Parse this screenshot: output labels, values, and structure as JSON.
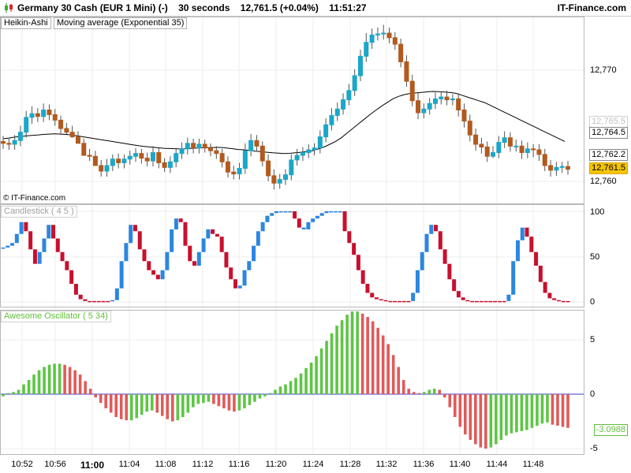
{
  "header": {
    "instrument": "Germany 30 Cash (EUR 1 Mini) (-)",
    "interval": "30 seconds",
    "quote": "12,761.5 (+0.04%)",
    "time": "11:51:27",
    "brand": "IT-Finance.com",
    "logo_icon": "candlestick-icon"
  },
  "price_panel": {
    "legend": [
      "Heikin-Ashi",
      "Moving average (Exponential 35)"
    ],
    "copyright": "© IT-Finance.com",
    "axis_ticks": [
      "12,770",
      "12,760"
    ],
    "labels": {
      "ema": "12,764.5",
      "top": "12,762.2",
      "last": "12,761.5",
      "hidden": "12,765.5"
    }
  },
  "stoch_panel": {
    "legend": "Candlestick ( 4 5 )",
    "axis_ticks": [
      "100",
      "50",
      "0"
    ]
  },
  "ao_panel": {
    "legend": "Awesome Oscillator ( 5 34)",
    "axis_ticks": [
      "5",
      "0",
      "-5"
    ],
    "value_label": "-3.0988"
  },
  "time_axis": [
    "10:52",
    "10:56",
    "11:00",
    "11:04",
    "11:08",
    "11:12",
    "11:16",
    "11:20",
    "11:24",
    "11:28",
    "11:32",
    "11:36",
    "11:40",
    "11:44",
    "11:48"
  ],
  "colors": {
    "bull": "#1aa7c9",
    "bear": "#b25a1e",
    "stoch_up": "#2c86e0",
    "stoch_down": "#c8102e",
    "ao_up": "#5ec545",
    "ao_down": "#e05a5a",
    "ema": "#000000",
    "zero_line": "#3a3acc",
    "last_price_bg": "#f5c400"
  },
  "chart_data": [
    {
      "type": "candlestick",
      "title": "Heikin-Ashi",
      "ylim": [
        12758,
        12778
      ],
      "open": [
        12764.6,
        12764.4,
        12764.3,
        12764.7,
        12765.6,
        12767.2,
        12767.6,
        12767.3,
        12768.0,
        12767.5,
        12766.9,
        12766.0,
        12765.6,
        12765.1,
        12764.4,
        12763.1,
        12763.0,
        12762.0,
        12761.4,
        12762.0,
        12762.7,
        12762.3,
        12762.7,
        12763.0,
        12763.3,
        12762.8,
        12762.5,
        12763.4,
        12762.3,
        12761.8,
        12762.4,
        12763.3,
        12763.8,
        12764.4,
        12763.9,
        12764.3,
        12763.9,
        12763.6,
        12763.3,
        12762.4,
        12761.3,
        12761.1,
        12761.7,
        12763.6,
        12764.7,
        12764.1,
        12762.5,
        12760.9,
        12760.1,
        12760.5,
        12761.0,
        12762.6,
        12763.1,
        12763.4,
        12763.7,
        12763.9,
        12765.1,
        12766.4,
        12767.4,
        12768.1,
        12769.1,
        12770.1,
        12771.7,
        12773.8,
        12775.3,
        12776.1,
        12776.2,
        12776.3,
        12775.8,
        12775.1,
        12773.2,
        12771.1,
        12769.0,
        12767.7,
        12768.1,
        12768.7,
        12769.2,
        12769.4,
        12769.1,
        12769.2,
        12768.0,
        12766.8,
        12765.3,
        12764.3,
        12764.0,
        12763.0,
        12763.4,
        12764.5,
        12765.0,
        12764.1,
        12764.1,
        12763.4,
        12763.8,
        12763.7,
        12763.2,
        12762.0,
        12761.5,
        12761.8,
        12761.9
      ],
      "close": [
        12764.4,
        12764.3,
        12764.7,
        12765.6,
        12767.2,
        12767.6,
        12767.3,
        12768.0,
        12767.5,
        12766.9,
        12766.0,
        12765.6,
        12765.1,
        12764.4,
        12763.1,
        12763.0,
        12762.0,
        12761.4,
        12762.0,
        12762.7,
        12762.3,
        12762.7,
        12763.0,
        12763.3,
        12762.8,
        12762.5,
        12763.4,
        12762.3,
        12761.8,
        12762.4,
        12763.3,
        12763.8,
        12764.4,
        12763.9,
        12764.3,
        12763.9,
        12763.6,
        12763.3,
        12762.4,
        12761.3,
        12761.1,
        12761.7,
        12763.6,
        12764.7,
        12764.1,
        12762.5,
        12760.9,
        12760.1,
        12760.5,
        12761.0,
        12762.6,
        12763.1,
        12763.4,
        12763.7,
        12763.9,
        12765.1,
        12766.4,
        12767.4,
        12768.1,
        12769.1,
        12770.1,
        12771.7,
        12773.8,
        12775.3,
        12776.1,
        12776.2,
        12776.3,
        12775.8,
        12775.1,
        12773.2,
        12771.1,
        12769.0,
        12767.7,
        12768.1,
        12768.7,
        12769.2,
        12769.4,
        12769.1,
        12769.2,
        12768.0,
        12766.8,
        12765.3,
        12764.3,
        12764.0,
        12763.0,
        12763.4,
        12764.5,
        12765.0,
        12764.1,
        12764.1,
        12763.4,
        12763.8,
        12763.7,
        12763.2,
        12762.0,
        12761.5,
        12761.8,
        12761.9,
        12761.6
      ],
      "high": [
        12765.2,
        12765.0,
        12765.3,
        12766.3,
        12767.9,
        12768.4,
        12768.2,
        12768.7,
        12768.6,
        12768.1,
        12767.4,
        12766.6,
        12766.3,
        12765.7,
        12764.9,
        12763.8,
        12763.6,
        12762.6,
        12762.7,
        12763.2,
        12763.3,
        12763.2,
        12763.6,
        12763.9,
        12763.8,
        12763.4,
        12764.1,
        12763.9,
        12762.8,
        12763.0,
        12763.9,
        12764.5,
        12765.0,
        12764.9,
        12764.9,
        12764.8,
        12764.4,
        12764.1,
        12763.8,
        12763.0,
        12762.0,
        12762.3,
        12764.4,
        12765.4,
        12765.3,
        12764.6,
        12763.2,
        12761.6,
        12761.1,
        12761.6,
        12763.2,
        12763.8,
        12764.0,
        12764.3,
        12764.4,
        12765.8,
        12767.1,
        12768.2,
        12768.8,
        12769.8,
        12770.8,
        12772.4,
        12774.5,
        12776.3,
        12776.8,
        12776.9,
        12777.2,
        12776.9,
        12776.4,
        12775.7,
        12773.9,
        12771.8,
        12769.8,
        12768.7,
        12769.3,
        12769.9,
        12770.0,
        12770.1,
        12769.7,
        12769.8,
        12768.7,
        12767.5,
        12766.0,
        12765.0,
        12764.6,
        12764.1,
        12765.2,
        12765.7,
        12765.6,
        12764.8,
        12764.7,
        12764.5,
        12764.3,
        12764.3,
        12763.8,
        12762.6,
        12762.4,
        12762.4,
        12762.5
      ],
      "low": [
        12763.8,
        12763.7,
        12763.7,
        12764.1,
        12765.0,
        12766.5,
        12766.7,
        12766.7,
        12766.9,
        12766.3,
        12765.4,
        12765.4,
        12765.0,
        12764.5,
        12763.4,
        12762.5,
        12762.4,
        12760.8,
        12760.8,
        12761.4,
        12761.7,
        12761.7,
        12762.1,
        12762.4,
        12762.2,
        12761.9,
        12761.9,
        12761.7,
        12761.3,
        12761.2,
        12761.8,
        12762.7,
        12763.2,
        12763.3,
        12763.3,
        12763.4,
        12763.0,
        12762.7,
        12761.8,
        12760.7,
        12760.5,
        12760.5,
        12761.1,
        12763.0,
        12763.5,
        12761.9,
        12760.3,
        12759.4,
        12759.5,
        12759.9,
        12760.4,
        12762.0,
        12762.5,
        12762.8,
        12763.1,
        12763.3,
        12764.5,
        12765.8,
        12766.8,
        12767.5,
        12768.5,
        12769.5,
        12771.1,
        12773.2,
        12774.6,
        12775.5,
        12775.6,
        12775.2,
        12774.5,
        12772.6,
        12770.5,
        12768.4,
        12767.0,
        12767.1,
        12767.5,
        12768.1,
        12768.6,
        12768.5,
        12768.5,
        12767.3,
        12766.1,
        12764.6,
        12763.6,
        12763.3,
        12762.4,
        12762.8,
        12762.8,
        12763.9,
        12763.5,
        12763.5,
        12762.7,
        12762.8,
        12762.9,
        12762.5,
        12761.4,
        12760.8,
        12760.9,
        12761.2,
        12761.0
      ]
    },
    {
      "type": "line",
      "title": "Moving average (Exponential 35)",
      "values": [
        12764.9,
        12764.97,
        12765.07,
        12765.13,
        12765.2,
        12765.26,
        12765.3,
        12765.36,
        12765.4,
        12765.43,
        12765.4,
        12765.36,
        12765.3,
        12765.2,
        12765.1,
        12765.0,
        12764.9,
        12764.8,
        12764.7,
        12764.6,
        12764.5,
        12764.4,
        12764.3,
        12764.2,
        12764.1,
        12764.04,
        12763.98,
        12763.92,
        12763.86,
        12763.84,
        12763.82,
        12763.8,
        12763.82,
        12763.86,
        12763.9,
        12763.92,
        12763.94,
        12763.96,
        12763.96,
        12763.9,
        12763.82,
        12763.74,
        12763.7,
        12763.64,
        12763.56,
        12763.5,
        12763.44,
        12763.38,
        12763.34,
        12763.3,
        12763.32,
        12763.38,
        12763.44,
        12763.5,
        12763.6,
        12763.8,
        12764.0,
        12764.3,
        12764.6,
        12765.0,
        12765.5,
        12766.0,
        12766.5,
        12767.0,
        12767.5,
        12767.96,
        12768.4,
        12768.8,
        12769.2,
        12769.46,
        12769.66,
        12769.78,
        12769.84,
        12769.9,
        12769.96,
        12770.0,
        12769.98,
        12769.94,
        12769.88,
        12769.8,
        12769.6,
        12769.4,
        12769.2,
        12769.0,
        12768.8,
        12768.5,
        12768.2,
        12767.9,
        12767.6,
        12767.3,
        12767.0,
        12766.7,
        12766.4,
        12766.1,
        12765.8,
        12765.5,
        12765.2,
        12764.9,
        12764.6
      ]
    },
    {
      "type": "bar",
      "title": "Candlestick ( 4 5 )",
      "ylim": [
        0,
        100
      ],
      "values": [
        60,
        62,
        65,
        75,
        88,
        78,
        58,
        42,
        55,
        70,
        85,
        70,
        55,
        45,
        35,
        20,
        8,
        3,
        1,
        1,
        1,
        1,
        1,
        1,
        2,
        15,
        45,
        65,
        85,
        78,
        58,
        45,
        35,
        30,
        25,
        35,
        55,
        80,
        92,
        88,
        62,
        45,
        40,
        55,
        70,
        80,
        75,
        72,
        55,
        38,
        25,
        15,
        18,
        35,
        45,
        62,
        78,
        88,
        95,
        98,
        100,
        100,
        100,
        100,
        92,
        82,
        80,
        88,
        92,
        95,
        98,
        100,
        100,
        100,
        100,
        78,
        65,
        52,
        35,
        20,
        10,
        5,
        3,
        2,
        1,
        1,
        1,
        1,
        1,
        1,
        10,
        35,
        55,
        75,
        85,
        78,
        58,
        42,
        25,
        12,
        5,
        2,
        1,
        1,
        1,
        1,
        1,
        1,
        1,
        1,
        1,
        8,
        45,
        68,
        82,
        72,
        55,
        40,
        22,
        10,
        4,
        2,
        1,
        1,
        1
      ],
      "rising": [
        true,
        true,
        true,
        true,
        true,
        false,
        false,
        false,
        true,
        true,
        true,
        false,
        false,
        false,
        false,
        false,
        false,
        false,
        false,
        false,
        false,
        false,
        false,
        false,
        true,
        true,
        true,
        true,
        true,
        false,
        false,
        false,
        false,
        false,
        false,
        true,
        true,
        true,
        true,
        false,
        false,
        false,
        false,
        true,
        true,
        true,
        false,
        false,
        false,
        false,
        false,
        false,
        true,
        true,
        true,
        true,
        true,
        true,
        true,
        true,
        true,
        true,
        true,
        true,
        false,
        false,
        true,
        true,
        true,
        true,
        true,
        true,
        true,
        true,
        true,
        false,
        false,
        false,
        false,
        false,
        false,
        false,
        false,
        false,
        false,
        false,
        false,
        false,
        false,
        false,
        true,
        true,
        true,
        true,
        true,
        false,
        false,
        false,
        false,
        false,
        false,
        false,
        false,
        false,
        false,
        false,
        false,
        false,
        false,
        false,
        false,
        true,
        true,
        true,
        true,
        false,
        false,
        false,
        false,
        false,
        false,
        false,
        false,
        false,
        false
      ]
    },
    {
      "type": "bar",
      "title": "Awesome Oscillator ( 5 34)",
      "ylim": [
        -5,
        7
      ],
      "values": [
        -0.2,
        0.1,
        0.2,
        0.4,
        0.9,
        1.3,
        1.8,
        2.2,
        2.5,
        2.7,
        2.8,
        2.8,
        2.7,
        2.5,
        2.2,
        1.8,
        1.2,
        0.5,
        -0.3,
        -0.8,
        -1.3,
        -1.7,
        -2.1,
        -2.3,
        -2.4,
        -2.4,
        -2.2,
        -1.9,
        -1.6,
        -1.5,
        -1.7,
        -2.0,
        -2.3,
        -2.5,
        -2.4,
        -2.1,
        -1.7,
        -1.2,
        -0.9,
        -0.8,
        -0.7,
        -0.9,
        -1.1,
        -1.3,
        -1.5,
        -1.6,
        -1.5,
        -1.3,
        -1.0,
        -0.7,
        -0.4,
        -0.2,
        0.1,
        0.4,
        0.7,
        0.9,
        1.2,
        1.5,
        1.9,
        2.4,
        2.9,
        3.5,
        4.2,
        4.9,
        5.6,
        6.3,
        6.8,
        7.3,
        7.6,
        7.6,
        7.4,
        7.1,
        6.7,
        6.1,
        5.4,
        4.6,
        3.6,
        2.5,
        1.3,
        0.5,
        0.2,
        0.1,
        0.2,
        0.4,
        0.5,
        0.4,
        -0.3,
        -1.2,
        -2.1,
        -3.0,
        -3.7,
        -4.2,
        -4.6,
        -4.9,
        -5.0,
        -4.9,
        -4.6,
        -4.2,
        -3.8,
        -3.6,
        -3.5,
        -3.4,
        -3.3,
        -3.1,
        -2.9,
        -2.7,
        -2.6,
        -2.8,
        -2.9,
        -3.0,
        -3.1
      ]
    }
  ]
}
